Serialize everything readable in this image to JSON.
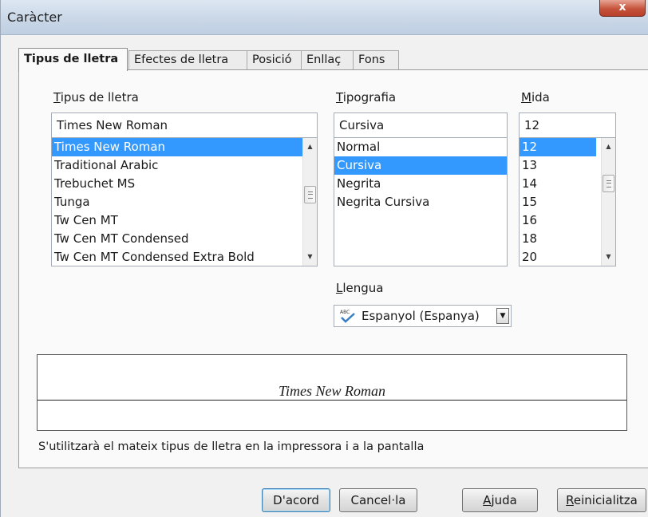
{
  "window": {
    "title": "Caràcter",
    "close_label": "x"
  },
  "tabs": [
    {
      "label": "Tipus de lletra",
      "active": true
    },
    {
      "label": "Efectes de lletra",
      "active": false
    },
    {
      "label": "Posició",
      "active": false
    },
    {
      "label": "Enllaç",
      "active": false
    },
    {
      "label": "Fons",
      "active": false
    }
  ],
  "font_family": {
    "label_first": "T",
    "label_rest": "ipus de lletra",
    "value": "Times New Roman",
    "items": [
      "Times New Roman",
      "Traditional Arabic",
      "Trebuchet MS",
      "Tunga",
      "Tw Cen MT",
      "Tw Cen MT Condensed",
      "Tw Cen MT Condensed Extra Bold"
    ],
    "selected": "Times New Roman"
  },
  "typeface": {
    "label_first": "T",
    "label_rest": "ipografia",
    "value": "Cursiva",
    "items": [
      "Normal",
      "Cursiva",
      "Negrita",
      "Negrita Cursiva"
    ],
    "selected": "Cursiva"
  },
  "size": {
    "label_first": "M",
    "label_rest": "ida",
    "value": "12",
    "items": [
      "12",
      "13",
      "14",
      "15",
      "16",
      "18",
      "20"
    ],
    "selected": "12"
  },
  "language": {
    "label_first": "L",
    "label_rest": "lengua",
    "value": "Espanyol (Espanya)",
    "icon": "spellcheck-icon"
  },
  "preview": {
    "text": "Times New Roman",
    "note": "S'utilitzarà el mateix tipus de lletra en la impressora i a la pantalla"
  },
  "buttons": {
    "ok": "D'acord",
    "cancel": "Cancel·la",
    "help_first": "A",
    "help_rest": "juda",
    "reset_first": "R",
    "reset_rest": "einicialitza"
  }
}
